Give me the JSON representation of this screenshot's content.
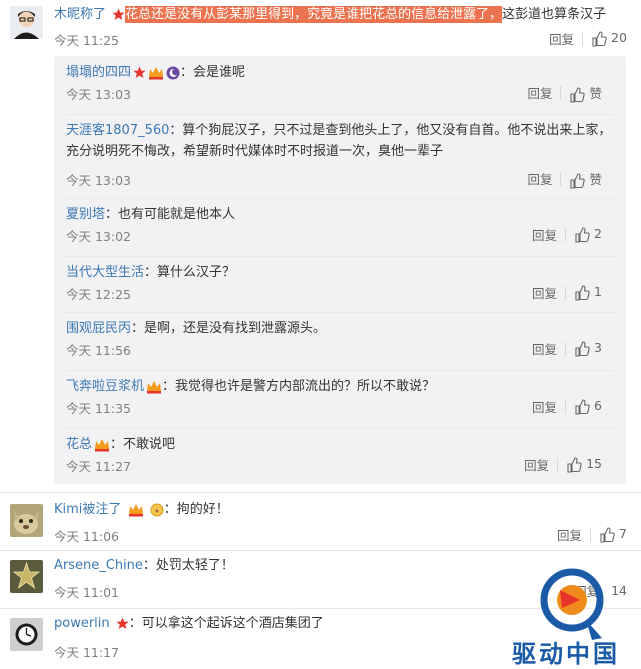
{
  "main_comment": {
    "author": "木昵称了",
    "text_highlighted": "花总还是没有从彭某那里得到，究竟是谁把花总的信息给泄露了，",
    "text_rest": "这彭道也算条汉子",
    "time": "今天 11:25",
    "reply_label": "回复",
    "likes": "20"
  },
  "replies": [
    {
      "author": "塌塌的四四",
      "text": "：会是谁呢",
      "time": "今天 13:03",
      "reply_label": "回复",
      "likes": "赞"
    },
    {
      "author": "天涯客1807_560",
      "text": "：算个狗屁汉子，只不过是查到他头上了，他又没有自首。他不说出来上家，充分说明死不悔改，希望新时代媒体时不时报道一次，臭他一辈子",
      "time": "今天 13:03",
      "reply_label": "回复",
      "likes": "赞"
    },
    {
      "author": "夏别塔",
      "text": "：也有可能就是他本人",
      "time": "今天 13:02",
      "reply_label": "回复",
      "likes": "2"
    },
    {
      "author": "当代大型生活",
      "text": "：算什么汉子？",
      "time": "今天 12:25",
      "reply_label": "回复",
      "likes": "1"
    },
    {
      "author": "围观屁民丙",
      "text": "：是啊，还是没有找到泄露源头。",
      "time": "今天 11:56",
      "reply_label": "回复",
      "likes": "3"
    },
    {
      "author": "飞奔啦豆浆机",
      "text": "：我觉得也许是警方内部流出的？所以不敢说？",
      "time": "今天 11:35",
      "reply_label": "回复",
      "likes": "6"
    },
    {
      "author": "花总",
      "text": "：不敢说吧",
      "time": "今天 11:27",
      "reply_label": "回复",
      "likes": "15"
    }
  ],
  "comments": [
    {
      "author": "Kimi被注了",
      "text": "：拘的好！",
      "time": "今天 11:06",
      "reply_label": "回复",
      "likes": "7"
    },
    {
      "author": "Arsene_Chine",
      "text": "：处罚太轻了！",
      "time": "今天 11:01",
      "reply_label": "回复",
      "likes": "14"
    },
    {
      "author": "powerlin",
      "text": "：可以拿这个起诉这个酒店集团了",
      "time": "今天 11:17",
      "reply_label": "",
      "likes": ""
    }
  ],
  "icons": {
    "thumb": "thumbs-up-icon",
    "red_star": "red-star-badge-icon",
    "vip": "vip-crown-badge-icon",
    "night": "night-badge-icon",
    "watermark": "drive-china-logo"
  },
  "watermark_text": "驱动中国",
  "colors": {
    "name_orange": "#eb7350",
    "name_blue": "#3d79b3",
    "highlight": "#eb7350",
    "sub_bg": "#f2f2f5",
    "watermark_blue": "#1a5aa6"
  }
}
